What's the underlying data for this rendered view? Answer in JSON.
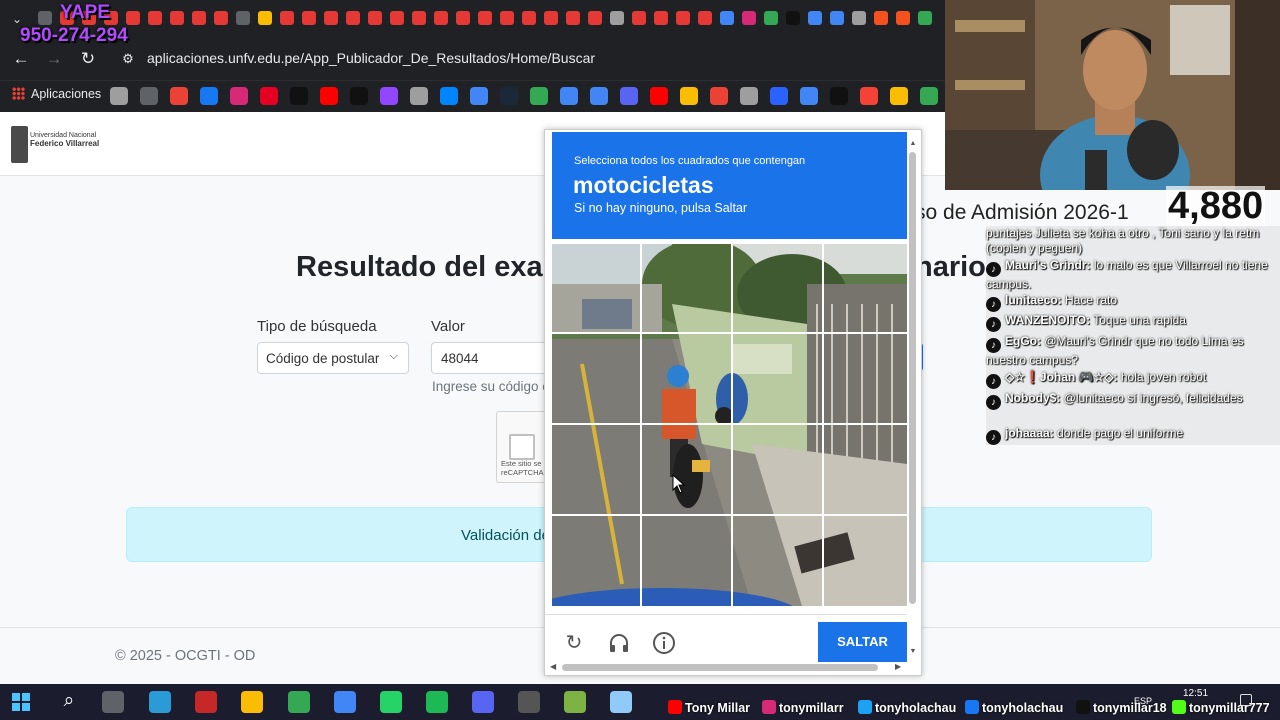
{
  "browser": {
    "url": "aplicaciones.unfv.edu.pe/App_Publicador_De_Resultados/Home/Buscar",
    "bookmarks_apps_label": "Aplicaciones"
  },
  "site": {
    "logo_line1": "Universidad Nacional",
    "logo_line2": "Federico Villarreal",
    "admision_title": "so de Admisión 2026-1",
    "result_title_left": "Resultado del exa",
    "result_title_right": "nario",
    "tipo_label": "Tipo de búsqueda",
    "tipo_value": "Código de postular",
    "valor_label": "Valor",
    "valor_value": "48044",
    "helper_text": "Ingrese su código c",
    "recaptcha_small_1": "Este sitio se",
    "recaptcha_small_2": "reCAPTCHA",
    "alert_text": "Validación de",
    "footer_text": "© 2025 - OCGTI - OD"
  },
  "captcha": {
    "instruction": "Selecciona todos los cuadrados que contengan",
    "target": "motocicletas",
    "hint": "Si no hay ninguno, pulsa Saltar",
    "skip_label": "SALTAR",
    "reload_icon": "refresh-icon",
    "audio_icon": "headphones-icon",
    "info_icon": "info-icon"
  },
  "overlay": {
    "yape_label": "YAPE",
    "yape_number": "950-274-294",
    "counter": "4,880"
  },
  "chat": [
    {
      "user": "",
      "text": "puntajes Julieta se koha a otro , Toni sano y la retm (copien y peguen)"
    },
    {
      "user": "Mauri's Grindr:",
      "text": " lo malo es que Villarroel no tiene campus."
    },
    {
      "user": "lunitaeco:",
      "text": " Hace rato"
    },
    {
      "user": "WANZENOITO:",
      "text": " Toque una rapida"
    },
    {
      "user": "EgGo:",
      "text": " @Mauri's Grindr que no todo Lima es nuestro campus?"
    },
    {
      "user": "◇☆❗Johan 🎮☆◇:",
      "text": " hola joven robot"
    },
    {
      "user": "Nobody$:",
      "text": " @lunitaeco sí ingresó, felicidades"
    },
    {
      "user": "johaaaa:",
      "text": " donde pago el uniforme"
    }
  ],
  "taskbar": {
    "social_1": "Tony Millar",
    "social_2": "tonymillarr",
    "social_3": "tonyholachau",
    "social_4": "tonyholachau",
    "social_5": "tonymillar18",
    "social_6": "tonymillar777",
    "time": "12:51",
    "lang": "ESP"
  },
  "colors": {
    "captcha_blue": "#1a73e8",
    "alert_bg": "#cff4fc",
    "yape_purple": "#b14bff"
  }
}
